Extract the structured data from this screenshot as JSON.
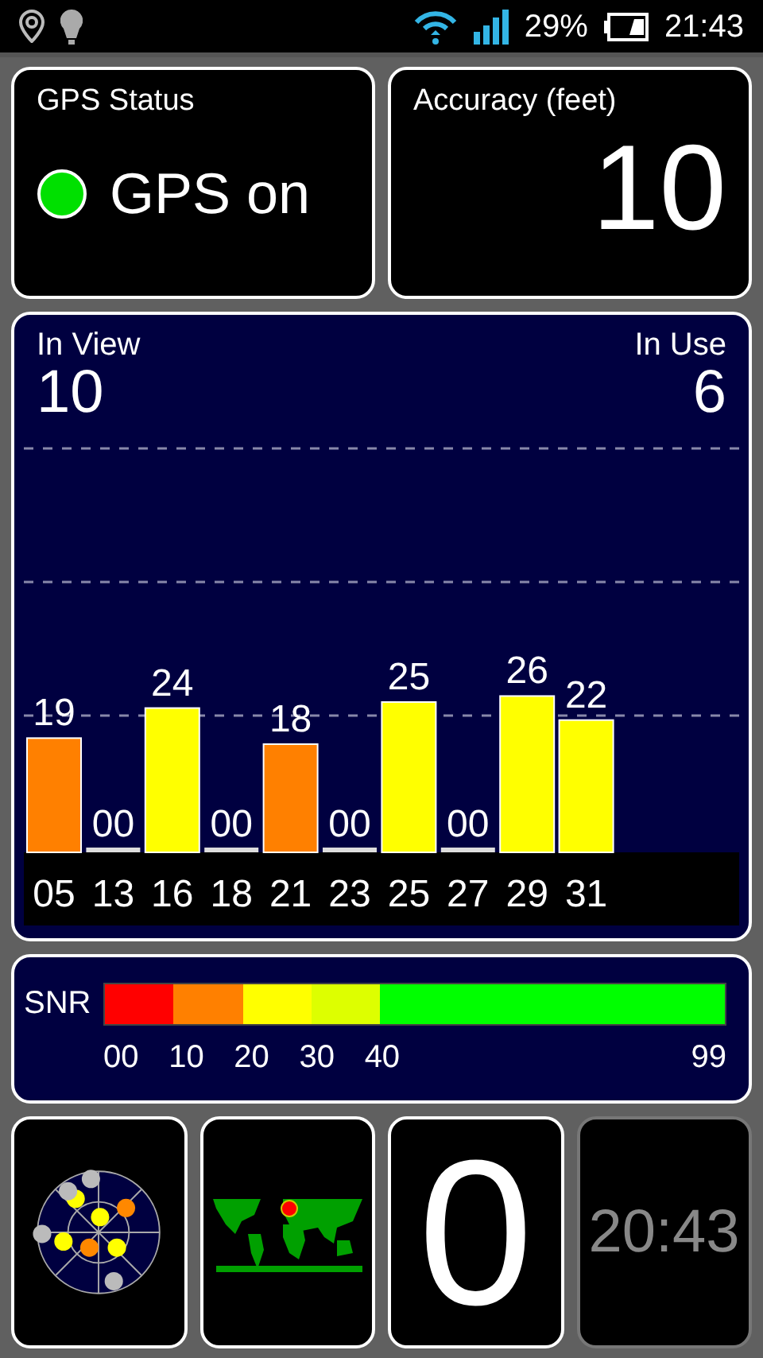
{
  "status_bar": {
    "battery": "29%",
    "time": "21:43"
  },
  "gps_status": {
    "title": "GPS Status",
    "text": "GPS on",
    "on": true
  },
  "accuracy": {
    "title": "Accuracy (feet)",
    "value": "10"
  },
  "satellites": {
    "in_view_label": "In View",
    "in_view": "10",
    "in_use_label": "In Use",
    "in_use": "6",
    "chart_data": {
      "type": "bar",
      "categories": [
        "05",
        "13",
        "16",
        "18",
        "21",
        "23",
        "25",
        "27",
        "29",
        "31"
      ],
      "values": [
        19,
        0,
        24,
        0,
        18,
        0,
        25,
        0,
        26,
        22
      ],
      "value_labels": [
        "19",
        "00",
        "24",
        "00",
        "18",
        "00",
        "25",
        "00",
        "26",
        "22"
      ]
    }
  },
  "snr": {
    "label": "SNR",
    "bands": [
      {
        "label": "00",
        "color": "#ff0000"
      },
      {
        "label": "10",
        "color": "#ff8000"
      },
      {
        "label": "20",
        "color": "#ffff00"
      },
      {
        "label": "30",
        "color": "#ddff00"
      },
      {
        "label": "40",
        "color": "#00ff00"
      }
    ],
    "max_label": "99"
  },
  "tiles": [
    {
      "kind": "skyplot"
    },
    {
      "kind": "map"
    },
    {
      "kind": "number",
      "value": "0"
    },
    {
      "kind": "clock",
      "value": "20:43"
    }
  ]
}
